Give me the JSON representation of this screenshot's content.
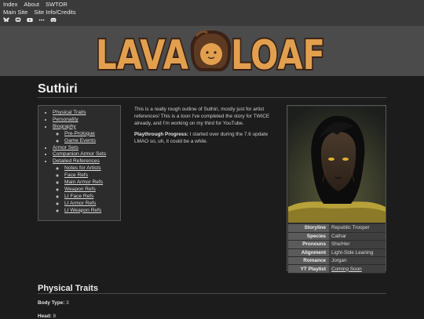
{
  "nav": {
    "row1": [
      "Index",
      "About",
      "SWTOR"
    ],
    "row2": [
      "Main Site",
      "Site Info/Credits"
    ],
    "social_icons": [
      "bluesky-icon",
      "mastodon-icon",
      "youtube-icon",
      "more-icon",
      "discord-icon"
    ]
  },
  "brand": {
    "logo_left": "LAVA",
    "logo_right": "LOAF",
    "colors": {
      "logo_fill": "#e2a04f",
      "logo_outline": "#3a2216",
      "banner_bg": "#4b4b4b"
    }
  },
  "page": {
    "title": "Suthiri"
  },
  "toc": {
    "items": [
      {
        "label": "Physical Traits",
        "children": []
      },
      {
        "label": "Personality",
        "children": []
      },
      {
        "label": "Biography",
        "children": [
          "Pre-Prologue",
          "Game Events"
        ]
      },
      {
        "label": "Armor Sets",
        "children": []
      },
      {
        "label": "Companion Armor Sets",
        "children": []
      },
      {
        "label": "Detailed References",
        "children": [
          "Notes for Artists",
          "Face Refs",
          "Main Armor Refs",
          "Weapon Refs",
          "LI Face Refs",
          "LI Armor Refs",
          "LI Weapon Refs"
        ]
      }
    ]
  },
  "intro": {
    "paragraph": "This is a really rough outline of Suthiri, mostly just for artist references! This is a toon I've completed the story for TWICE already, and I'm working on my third for YouTube.",
    "progress_label": "Playthrough Progress:",
    "progress_text": " I started over during the 7.6 update LMAO so, uh, it could be a while."
  },
  "info": {
    "rows": [
      {
        "key": "Storyline",
        "value": "Republic Trooper"
      },
      {
        "key": "Species",
        "value": "Cathar"
      },
      {
        "key": "Pronouns",
        "value": "She/Her"
      },
      {
        "key": "Alignment",
        "value": "Light-Side Leaning"
      },
      {
        "key": "Romance",
        "value": "Jorgan"
      },
      {
        "key": "YT Playlist",
        "value": "Coming Soon"
      }
    ]
  },
  "traits": {
    "section_title": "Physical Traits",
    "body_type_label": "Body Type:",
    "body_type_value": " 3",
    "head_label": "Head:",
    "head_value": " 8"
  }
}
